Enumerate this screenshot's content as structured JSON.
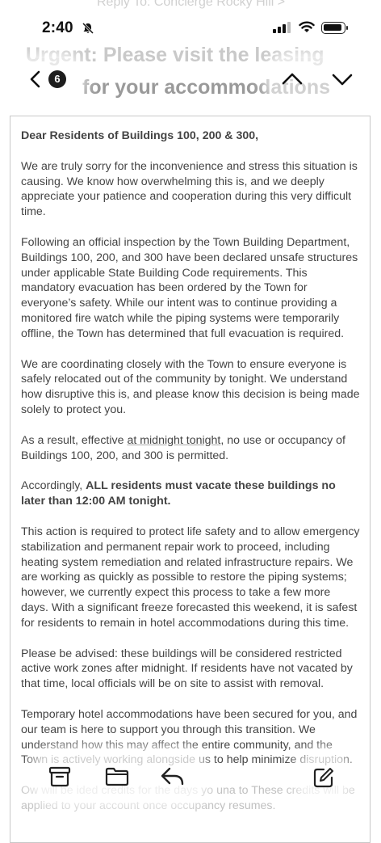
{
  "status_bar": {
    "time": "2:40"
  },
  "header": {
    "reply_to": "Reply To: Concierge Rocky Hill >",
    "subject_line1": "Urgent: Please visit the leasing",
    "subject_line2": "for your accommodations",
    "unread_count": "6"
  },
  "email": {
    "greeting": "Dear Residents of Buildings 100, 200 & 300,",
    "p1": "We are truly sorry for the inconvenience and stress this situation is causing. We know how overwhelming this is, and we deeply appreciate your patience and cooperation during this very difficult time.",
    "p2": "Following an official inspection by the Town Building Department, Buildings 100, 200, and 300 have been declared unsafe structures under applicable State Building Code requirements. This mandatory evacuation has been ordered by the Town for everyone’s safety. While our intent was to continue providing a monitored fire watch while the piping systems were temporarily offline, the Town has determined that full evacuation is required.",
    "p3": "We are coordinating closely with the Town to ensure everyone is safely relocated out of the community by tonight. We understand how disruptive this is, and please know this decision is being made solely to protect you.",
    "p4_pre": "As a result, effective ",
    "p4_link": "at midnight tonight",
    "p4_post": ", no use or occupancy of Buildings 100, 200, and 300 is permitted.",
    "p5_pre": "Accordingly, ",
    "p5_bold": "ALL residents must vacate these buildings no later than 12:00 AM tonight.",
    "p6": "This action is required to protect life safety and to allow emergency stabilization and permanent repair work to proceed, including heating system remediation and related infrastructure repairs. We are working as quickly as possible to restore the piping systems; however, we currently expect this process to take a few more days. With a significant freeze forecasted this weekend, it is safest for residents to remain in hotel accommodations during this time.",
    "p7": "Please be advised: these buildings will be considered restricted active work zones after midnight. If residents have not vacated by that time, local officials will be on site to assist with removal.",
    "p8": "Temporary hotel accommodations have been secured for you, and our team is here to support you through this transition. We understand how this may affect the entire community, and the Town is actively working alongside us to help minimize disruption.",
    "p9": "Ow          will be      ided credits for the days yo          una      to          These credits will be applied to your account once occupancy resumes."
  },
  "toolbar": {
    "archive_icon": "archive-icon",
    "folder_icon": "folder-icon",
    "reply_icon": "reply-icon",
    "compose_icon": "compose-icon"
  }
}
